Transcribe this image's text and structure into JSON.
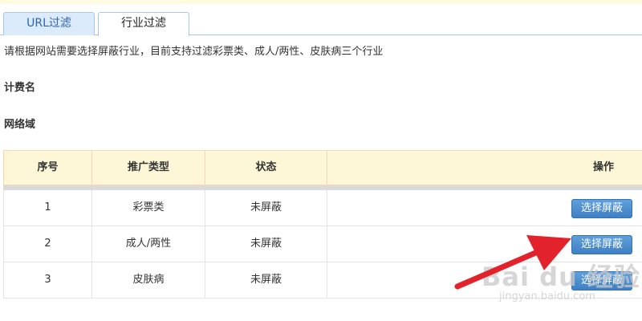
{
  "tabs": [
    {
      "label": "URL过滤",
      "active": false
    },
    {
      "label": "行业过滤",
      "active": true
    }
  ],
  "description": "请根据网站需要选择屏蔽行业，目前支持过滤彩票类、成人/两性、皮肤病三个行业",
  "fields": {
    "billing_name_label": "计费名",
    "domain_label": "网络域"
  },
  "table": {
    "headers": [
      "序号",
      "推广类型",
      "状态",
      "操作"
    ],
    "rows": [
      {
        "index": "1",
        "type": "彩票类",
        "status": "未屏蔽",
        "action": "选择屏蔽"
      },
      {
        "index": "2",
        "type": "成人/两性",
        "status": "未屏蔽",
        "action": "选择屏蔽"
      },
      {
        "index": "3",
        "type": "皮肤病",
        "status": "未屏蔽",
        "action": "选择屏蔽"
      }
    ]
  },
  "watermark": {
    "brand": "Bai du 经验",
    "url": "jingyan.baidu.com"
  },
  "colors": {
    "tab_inactive_bg": "#dcebfb",
    "header_bg": "#fdf7d7",
    "button": "#4a8bd0",
    "annotation_arrow": "#e3232b"
  }
}
